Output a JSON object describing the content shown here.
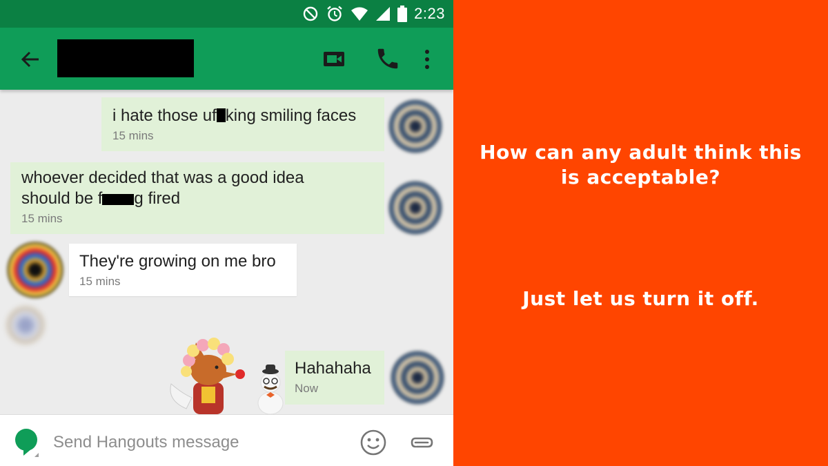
{
  "status_bar": {
    "time": "2:23",
    "icons": [
      "do-not-disturb-icon",
      "alarm-icon",
      "wifi-icon",
      "signal-icon",
      "battery-icon"
    ]
  },
  "app_bar": {
    "icons": [
      "back-arrow-icon",
      "video-call-icon",
      "phone-icon",
      "more-vert-icon"
    ],
    "color": "#0f9d58"
  },
  "messages": [
    {
      "direction": "outgoing",
      "text_before": "i hate those uf",
      "text_after": "king smiling faces",
      "time": "15 mins"
    },
    {
      "direction": "outgoing",
      "line1": "whoever decided that was a good idea",
      "line2_before": "should be f",
      "line2_after": "g fired",
      "time": "15 mins"
    },
    {
      "direction": "incoming",
      "text": "They're growing on me bro",
      "time": "15 mins"
    },
    {
      "direction": "outgoing",
      "text": "Hahahaha",
      "time": "Now"
    }
  ],
  "composer": {
    "placeholder": "Send Hangouts message",
    "icons": [
      "hangouts-icon",
      "emoji-icon",
      "attach-icon"
    ]
  },
  "caption": {
    "line1": "How can any adult think this",
    "line2": "is acceptable?",
    "line3": "Just let us turn it off.",
    "background": "#ff4500"
  },
  "colors": {
    "status_bar": "#0b8043",
    "outgoing_bubble": "#e1f1d8",
    "incoming_bubble": "#ffffff",
    "chat_background": "#ececec"
  }
}
